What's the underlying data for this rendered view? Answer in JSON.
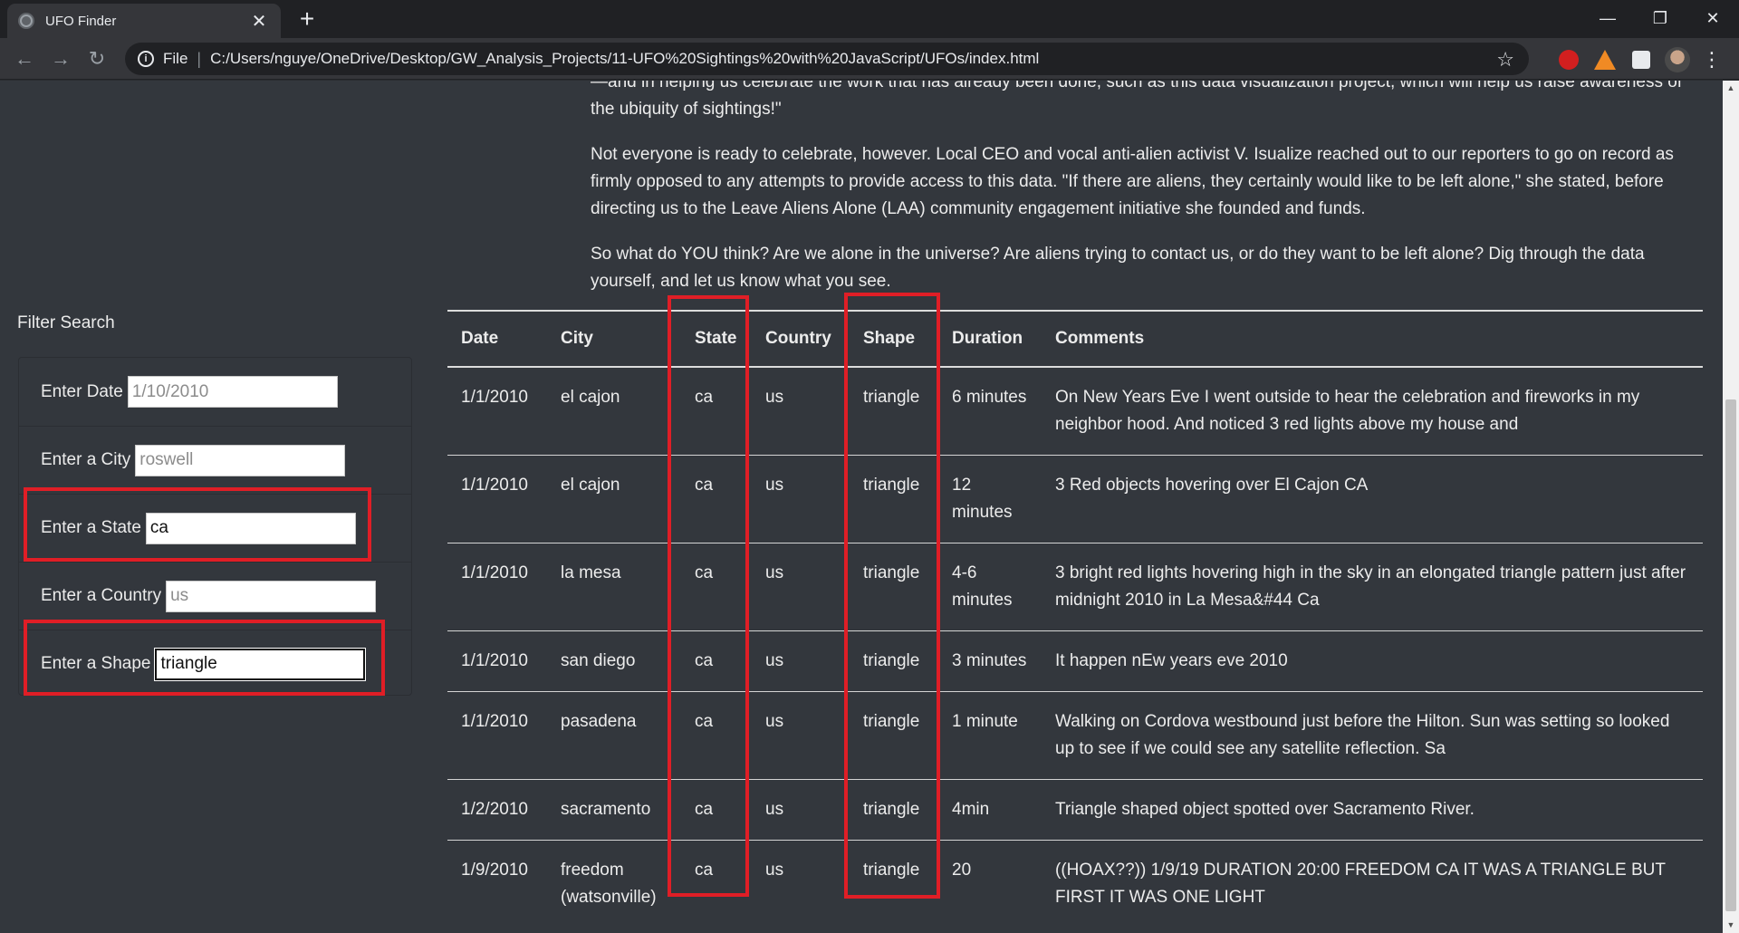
{
  "browser": {
    "tab_title": "UFO Finder",
    "scheme_label": "File",
    "url": "C:/Users/nguye/OneDrive/Desktop/GW_Analysis_Projects/11-UFO%20Sightings%20with%20JavaScript/UFOs/index.html"
  },
  "story": {
    "paragraph_1": "—and in helping us celebrate the work that has already been done, such as this data visualization project, which will help us raise awareness of the ubiquity of sightings!\"",
    "paragraph_2": "Not everyone is ready to celebrate, however. Local CEO and vocal anti-alien activist V. Isualize reached out to our reporters to go on record as firmly opposed to any attempts to provide access to this data. \"If there are aliens, they certainly would like to be left alone,\" she stated, before directing us to the Leave Aliens Alone (LAA) community engagement initiative she founded and funds.",
    "paragraph_3": "So what do YOU think? Are we alone in the universe? Are aliens trying to contact us, or do they want to be left alone? Dig through the data yourself, and let us know what you see."
  },
  "filters": {
    "title": "Filter Search",
    "date": {
      "label": "Enter Date",
      "value": "",
      "placeholder": "1/10/2010"
    },
    "city": {
      "label": "Enter a City",
      "value": "",
      "placeholder": "roswell"
    },
    "state": {
      "label": "Enter a State",
      "value": "ca",
      "placeholder": ""
    },
    "country": {
      "label": "Enter a Country",
      "value": "",
      "placeholder": "us"
    },
    "shape": {
      "label": "Enter a Shape",
      "value": "triangle",
      "placeholder": ""
    }
  },
  "table": {
    "headers": [
      "Date",
      "City",
      "State",
      "Country",
      "Shape",
      "Duration",
      "Comments"
    ],
    "rows": [
      [
        "1/1/2010",
        "el cajon",
        "ca",
        "us",
        "triangle",
        "6 minutes",
        "On New Years Eve I went outside to hear the celebration and fireworks in my neighbor hood. And noticed 3 red lights above my house and"
      ],
      [
        "1/1/2010",
        "el cajon",
        "ca",
        "us",
        "triangle",
        "12 minutes",
        "3 Red objects hovering over El Cajon CA"
      ],
      [
        "1/1/2010",
        "la mesa",
        "ca",
        "us",
        "triangle",
        "4-6 minutes",
        "3 bright red lights hovering high in the sky in an elongated triangle pattern just after midnight 2010 in La Mesa&#44 Ca"
      ],
      [
        "1/1/2010",
        "san diego",
        "ca",
        "us",
        "triangle",
        "3 minutes",
        "It happen nEw years eve 2010"
      ],
      [
        "1/1/2010",
        "pasadena",
        "ca",
        "us",
        "triangle",
        "1 minute",
        "Walking on Cordova westbound just before the Hilton. Sun was setting so looked up to see if we could see any satellite reflection. Sa"
      ],
      [
        "1/2/2010",
        "sacramento",
        "ca",
        "us",
        "triangle",
        "4min",
        "Triangle shaped object spotted over Sacramento River."
      ],
      [
        "1/9/2010",
        "freedom (watsonville)",
        "ca",
        "us",
        "triangle",
        "20",
        "((HOAX??)) 1/9/19 DURATION 20:00 FREEDOM CA IT WAS A TRIANGLE BUT FIRST IT WAS ONE LIGHT"
      ]
    ]
  },
  "colors": {
    "highlight": "#e01e26",
    "page_bg": "#33373d",
    "chrome_bg": "#202124"
  }
}
